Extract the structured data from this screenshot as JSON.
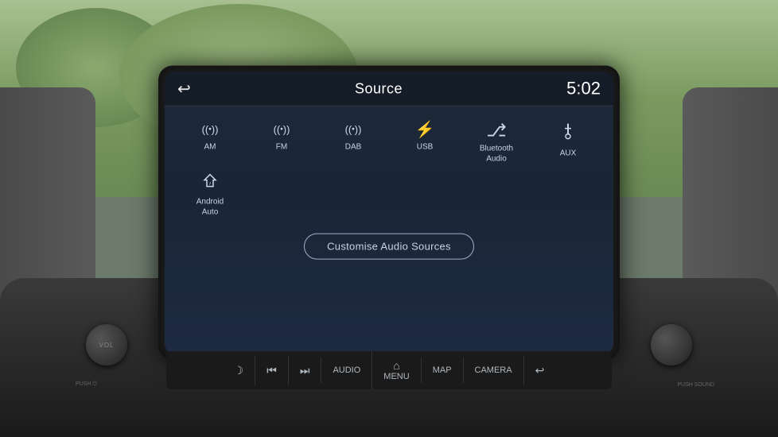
{
  "screen": {
    "title": "Source",
    "clock": "5:02",
    "back_icon": "↩"
  },
  "sources": [
    {
      "id": "am",
      "label": "AM",
      "icon": "radio-waves"
    },
    {
      "id": "fm",
      "label": "FM",
      "icon": "radio-waves"
    },
    {
      "id": "dab",
      "label": "DAB",
      "icon": "radio-waves"
    },
    {
      "id": "usb",
      "label": "USB",
      "icon": "usb"
    },
    {
      "id": "bluetooth-audio",
      "label": "Bluetooth\nAudio",
      "icon": "bluetooth"
    },
    {
      "id": "aux",
      "label": "AUX",
      "icon": "aux"
    }
  ],
  "sources_row2": [
    {
      "id": "android-auto",
      "label": "Android\nAuto",
      "icon": "android"
    }
  ],
  "customise_btn": "Customise Audio Sources",
  "controls": [
    {
      "id": "media-toggle",
      "label": "",
      "icon": "☽"
    },
    {
      "id": "prev",
      "label": "",
      "icon": "⏮"
    },
    {
      "id": "next",
      "label": "",
      "icon": "⏭"
    },
    {
      "id": "audio",
      "label": "AUDIO",
      "icon": ""
    },
    {
      "id": "menu",
      "label": "MENU",
      "icon": "⌂"
    },
    {
      "id": "map",
      "label": "MAP",
      "icon": ""
    },
    {
      "id": "camera",
      "label": "CAMERA",
      "icon": ""
    },
    {
      "id": "back",
      "label": "",
      "icon": "↩"
    }
  ],
  "vol_label": "VOL",
  "vol_push_label": "PUSH ⏻",
  "sound_push_label": "PUSH SOUND",
  "colors": {
    "screen_bg": "#1e2a3a",
    "header_text": "#ffffff",
    "source_icon": "#d0d8e8",
    "source_label": "#c8d4e4",
    "btn_border": "#a0b0c8",
    "btn_text": "#c8d4e4",
    "ctrl_text": "#b0b8c0"
  }
}
